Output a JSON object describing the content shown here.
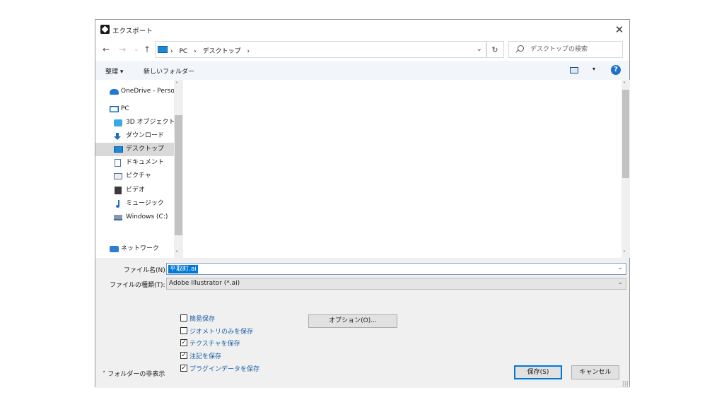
{
  "window": {
    "title": "エクスポート",
    "close_glyph": "✕"
  },
  "address": {
    "back": "←",
    "forward": "→",
    "recent": "⌄",
    "up": "↑",
    "breadcrumb": [
      "›",
      "PC",
      "›",
      "デスクトップ",
      "›"
    ],
    "dropdown_glyph": "⌄",
    "refresh_glyph": "↻",
    "search_placeholder": "デスクトップの検索"
  },
  "toolbar": {
    "organize": "整理 ▾",
    "new_folder": "新しいフォルダー",
    "view_arrow": "▾",
    "help": "?"
  },
  "nav": {
    "items": [
      {
        "label": "OneDrive - Persor",
        "icon": "cloud-icon"
      },
      {
        "label": "PC",
        "icon": "pc-icon"
      },
      {
        "label": "3D オブジェクト",
        "icon": "3d-objects-icon"
      },
      {
        "label": "ダウンロード",
        "icon": "download-icon"
      },
      {
        "label": "デスクトップ",
        "icon": "desktop-icon",
        "selected": true
      },
      {
        "label": "ドキュメント",
        "icon": "document-icon"
      },
      {
        "label": "ピクチャ",
        "icon": "pictures-icon"
      },
      {
        "label": "ビデオ",
        "icon": "video-icon"
      },
      {
        "label": "ミュージック",
        "icon": "music-icon"
      },
      {
        "label": "Windows (C:)",
        "icon": "drive-icon"
      },
      {
        "label": "ネットワーク",
        "icon": "network-icon"
      }
    ],
    "scroll_up": "˄",
    "scroll_down": "˅"
  },
  "list": {
    "scroll_up": "˄",
    "scroll_down": "˅"
  },
  "form": {
    "filename_label": "ファイル名(N):",
    "filename_value": "平取町.ai",
    "filetype_label": "ファイルの種類(T):",
    "filetype_value": "Adobe Illustrator (*.ai)",
    "combo_arrow": "⌄",
    "options_button": "オプション(O)...",
    "checkboxes": [
      {
        "label": "簡易保存",
        "checked": false
      },
      {
        "label": "ジオメトリのみを保存",
        "checked": false
      },
      {
        "label": "テクスチャを保存",
        "checked": true
      },
      {
        "label": "注記を保存",
        "checked": true
      },
      {
        "label": "プラグインデータを保存",
        "checked": true
      }
    ],
    "check_glyph": "✓"
  },
  "footer": {
    "hide_folders": "˄  フォルダーの非表示",
    "save_button": "保存(S)",
    "cancel_button": "キャンセル"
  },
  "colors": {
    "accent": "#0078d7",
    "link_blue": "#1e5fa8",
    "panel_bg": "#f0f0f0"
  }
}
